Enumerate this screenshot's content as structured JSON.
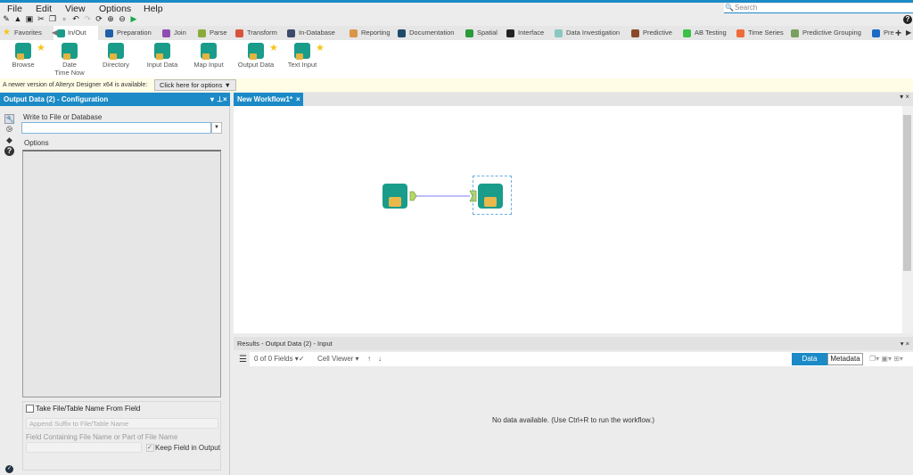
{
  "menu": [
    "File",
    "Edit",
    "View",
    "Options",
    "Help"
  ],
  "search": {
    "placeholder": "Search"
  },
  "toolbar_icons": [
    "new-icon",
    "open-icon",
    "save-icon",
    "cut-icon",
    "copy-icon",
    "paste-icon",
    "undo-icon",
    "redo-icon",
    "refresh-icon",
    "zoom-in-icon",
    "zoom-out-icon",
    "run-icon"
  ],
  "tabs": [
    {
      "label": "Favorites",
      "color": "#f5c518"
    },
    {
      "label": "In/Out",
      "color": "#1a9c8a",
      "active": true
    },
    {
      "label": "Preparation",
      "color": "#1f5fa8"
    },
    {
      "label": "Join",
      "color": "#8e4fb0"
    },
    {
      "label": "Parse",
      "color": "#8aab3c"
    },
    {
      "label": "Transform",
      "color": "#d9533c"
    },
    {
      "label": "In-Database",
      "color": "#3c4a6b"
    },
    {
      "label": "Reporting",
      "color": "#d9954a"
    },
    {
      "label": "Documentation",
      "color": "#1d4a6b"
    },
    {
      "label": "Spatial",
      "color": "#2a9a3a"
    },
    {
      "label": "Interface",
      "color": "#222222"
    },
    {
      "label": "Data Investigation",
      "color": "#8ac7c0"
    },
    {
      "label": "Predictive",
      "color": "#8a4a2a"
    },
    {
      "label": "AB Testing",
      "color": "#3cc04a"
    },
    {
      "label": "Time Series",
      "color": "#f06a3a"
    },
    {
      "label": "Predictive Grouping",
      "color": "#7aa060"
    },
    {
      "label": "Pre",
      "color": "#1b6ac6"
    }
  ],
  "tools": [
    {
      "label": "Browse",
      "fav": true
    },
    {
      "label": "Date Time Now",
      "fav": false
    },
    {
      "label": "Directory",
      "fav": false
    },
    {
      "label": "Input Data",
      "fav": false
    },
    {
      "label": "Map Input",
      "fav": false
    },
    {
      "label": "Output Data",
      "fav": true
    },
    {
      "label": "Text Input",
      "fav": true
    }
  ],
  "notice": {
    "text": "A newer version of Alteryx Designer x64 is available:",
    "button": "Click here for options ▼"
  },
  "config": {
    "title": "Output Data (2) - Configuration",
    "write_label": "Write to File or Database",
    "write_value": "",
    "options_label": "Options",
    "take_label": "Take File/Table Name From Field",
    "append_label": "Append Suffix to File/Table Name",
    "field_label": "Field Containing File Name or Part of File Name",
    "keep_label": "Keep Field in Output",
    "keep_checked": true,
    "take_checked": false
  },
  "workflow": {
    "tab": "New Workflow1*"
  },
  "results": {
    "title": "Results - Output Data (2) - Input",
    "fields": "0 of 0 Fields",
    "viewer": "Cell Viewer",
    "data_btn": "Data",
    "meta_btn": "Metadata",
    "empty": "No data available. (Use Ctrl+R to run the workflow.)"
  }
}
